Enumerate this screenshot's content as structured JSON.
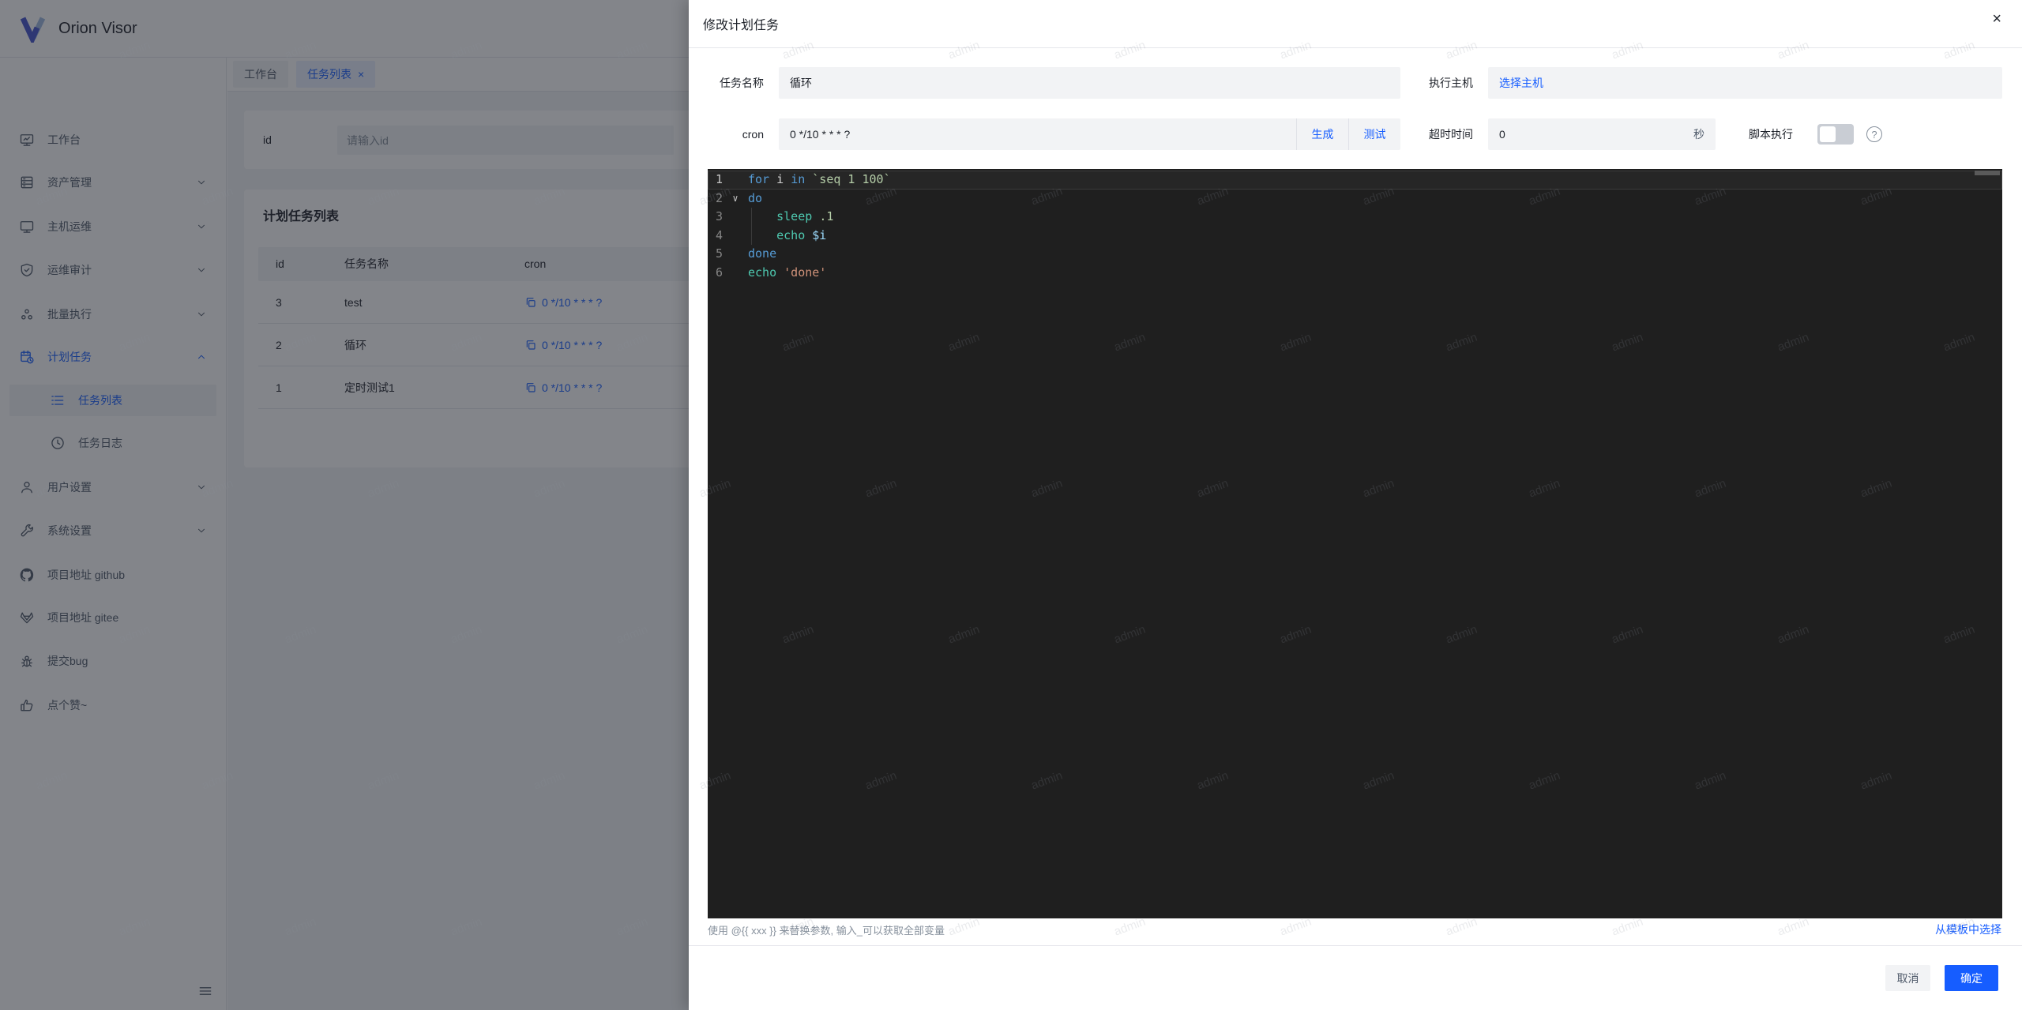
{
  "app": {
    "title": "Orion Visor"
  },
  "colors": {
    "accent": "#165dff",
    "mask": "rgba(29,33,41,0.55)",
    "editor_bg": "#1f1f1f",
    "token_keyword": "#569cd6",
    "token_command": "#4ec9b0",
    "token_string_backtick": "#b5cea8",
    "token_string_single": "#ce9178",
    "token_variable": "#9cdcfe"
  },
  "watermark": {
    "text": "admin"
  },
  "sidebar": {
    "items": [
      {
        "label": "工作台",
        "icon": "dashboard-icon",
        "type": "item"
      },
      {
        "label": "资产管理",
        "icon": "assets-icon",
        "type": "item",
        "chevron": "down"
      },
      {
        "label": "主机运维",
        "icon": "host-icon",
        "type": "item",
        "chevron": "down"
      },
      {
        "label": "运维审计",
        "icon": "audit-icon",
        "type": "item",
        "chevron": "down"
      },
      {
        "label": "批量执行",
        "icon": "batch-icon",
        "type": "item",
        "chevron": "down"
      },
      {
        "label": "计划任务",
        "icon": "schedule-icon",
        "type": "item",
        "chevron": "up",
        "blue": true
      },
      {
        "label": "任务列表",
        "icon": "list-icon",
        "type": "sub",
        "selected": true
      },
      {
        "label": "任务日志",
        "icon": "log-icon",
        "type": "sub"
      },
      {
        "label": "用户设置",
        "icon": "user-icon",
        "type": "item",
        "chevron": "down"
      },
      {
        "label": "系统设置",
        "icon": "settings-icon",
        "type": "item",
        "chevron": "down"
      },
      {
        "label": "项目地址 github",
        "icon": "github-icon",
        "type": "item"
      },
      {
        "label": "项目地址 gitee",
        "icon": "gitee-icon",
        "type": "item"
      },
      {
        "label": "提交bug",
        "icon": "bug-icon",
        "type": "item"
      },
      {
        "label": "点个赞~",
        "icon": "like-icon",
        "type": "item"
      }
    ]
  },
  "tabs": [
    {
      "label": "工作台",
      "active": false,
      "closable": false
    },
    {
      "label": "任务列表",
      "active": true,
      "closable": true
    }
  ],
  "filter": {
    "id_label": "id",
    "id_placeholder": "请输入id"
  },
  "table": {
    "title": "计划任务列表",
    "columns": [
      "id",
      "任务名称",
      "cron"
    ],
    "rows": [
      {
        "id": "3",
        "name": "test",
        "cron": "0 */10 * * * ?"
      },
      {
        "id": "2",
        "name": "循环",
        "cron": "0 */10 * * * ?"
      },
      {
        "id": "1",
        "name": "定时测试1",
        "cron": "0 */10 * * * ?"
      }
    ]
  },
  "modal": {
    "title": "修改计划任务",
    "close_label": "×",
    "fields": {
      "name_label": "任务名称",
      "name_value": "循环",
      "host_label": "执行主机",
      "host_link": "选择主机",
      "cron_label": "cron",
      "cron_value": "0 */10 * * * ?",
      "generate_label": "生成",
      "test_label": "测试",
      "timeout_label": "超时时间",
      "timeout_value": "0",
      "timeout_unit": "秒",
      "script_label": "脚本执行",
      "help_label": "?"
    },
    "editor": {
      "lines": [
        {
          "no": "1",
          "current": true,
          "tokens": [
            [
              "kw",
              "for"
            ],
            [
              "plain",
              " i "
            ],
            [
              "kw",
              "in"
            ],
            [
              "plain",
              " "
            ],
            [
              "str",
              "`seq 1 100`"
            ]
          ]
        },
        {
          "no": "2",
          "fold": true,
          "tokens": [
            [
              "kw",
              "do"
            ]
          ]
        },
        {
          "no": "3",
          "guide": true,
          "tokens": [
            [
              "plain",
              "    "
            ],
            [
              "cmd",
              "sleep"
            ],
            [
              "plain",
              " "
            ],
            [
              "num",
              ".1"
            ]
          ]
        },
        {
          "no": "4",
          "guide": true,
          "tokens": [
            [
              "plain",
              "    "
            ],
            [
              "cmd",
              "echo"
            ],
            [
              "plain",
              " "
            ],
            [
              "var",
              "$i"
            ]
          ]
        },
        {
          "no": "5",
          "tokens": [
            [
              "kw",
              "done"
            ]
          ]
        },
        {
          "no": "6",
          "tokens": [
            [
              "cmd",
              "echo"
            ],
            [
              "plain",
              " "
            ],
            [
              "sqstr",
              "'done'"
            ]
          ]
        }
      ],
      "fold_glyph": "∨"
    },
    "hint": "使用 @{{ xxx }} 来替换参数, 输入_可以获取全部变量",
    "template_link": "从模板中选择",
    "cancel_label": "取消",
    "ok_label": "确定"
  }
}
